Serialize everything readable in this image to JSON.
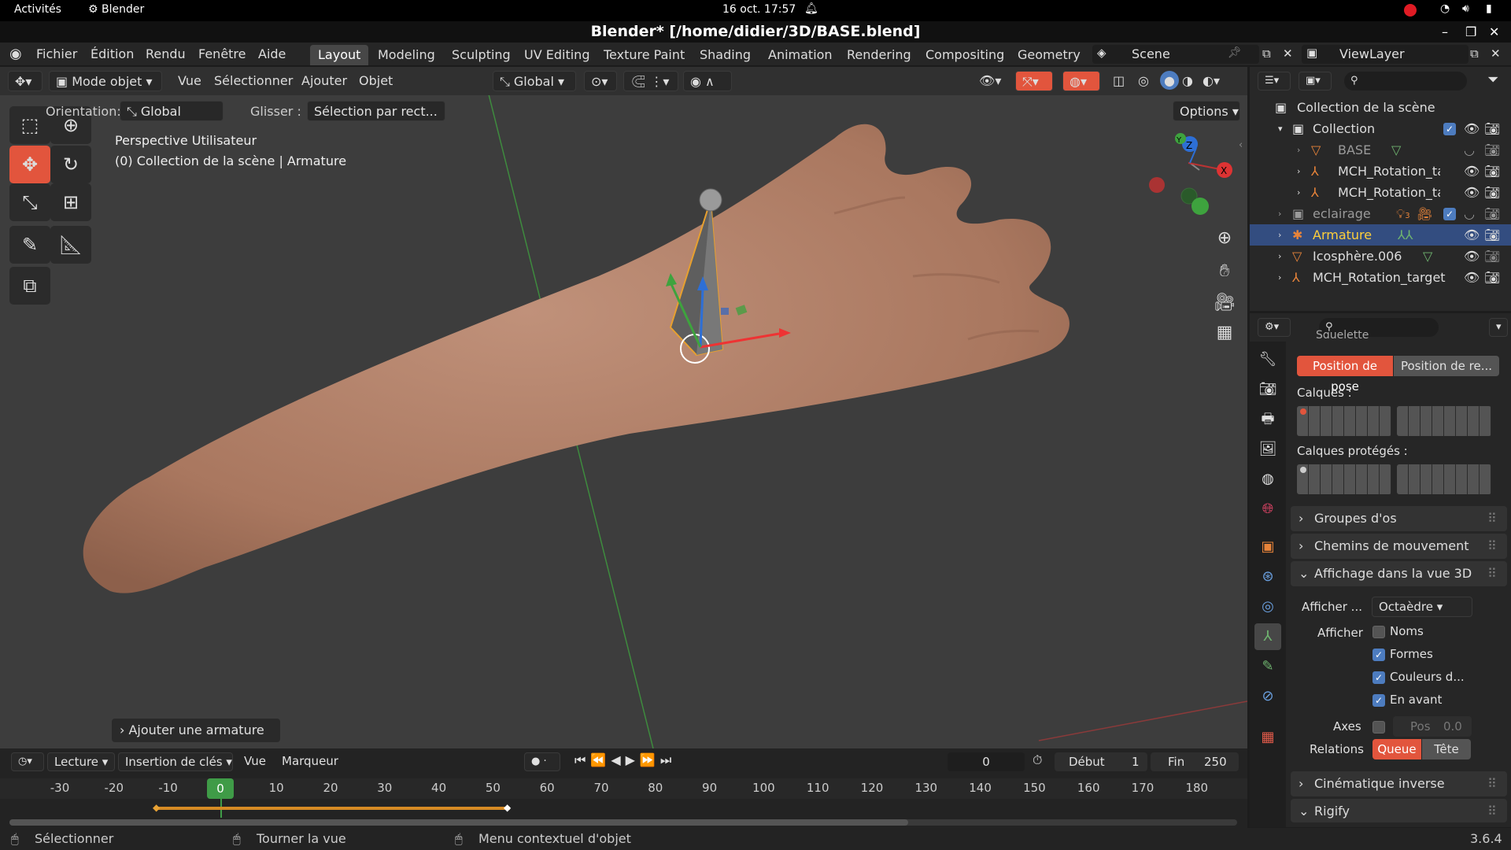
{
  "gnome": {
    "activities": "Activités",
    "app": "Blender",
    "datetime": "16 oct.  17:57"
  },
  "window_title": "Blender* [/home/didier/3D/BASE.blend]",
  "menu": [
    "Fichier",
    "Édition",
    "Rendu",
    "Fenêtre",
    "Aide"
  ],
  "workspaces": [
    "Layout",
    "Modeling",
    "Sculpting",
    "UV Editing",
    "Texture Paint",
    "Shading",
    "Animation",
    "Rendering",
    "Compositing",
    "Geometry N"
  ],
  "scene": {
    "label": "Scene",
    "viewlayer": "ViewLayer"
  },
  "viewport_header": {
    "mode": "Mode objet",
    "menus": [
      "Vue",
      "Sélectionner",
      "Ajouter",
      "Objet"
    ],
    "transform": "Global"
  },
  "tool_settings": {
    "orientation_label": "Orientation:",
    "orientation_value": "Global",
    "drag_label": "Glisser :",
    "drag_value": "Sélection par rect...",
    "options": "Options"
  },
  "viewport_info": {
    "line1": "Perspective Utilisateur",
    "line2": "(0) Collection de la scène | Armature"
  },
  "last_op": "Ajouter une armature",
  "gizmo": {
    "x": "X",
    "y": "Y",
    "z": "Z"
  },
  "outliner": {
    "root": "Collection de la scène",
    "rows": [
      {
        "name": "Collection"
      },
      {
        "name": "BASE"
      },
      {
        "name": "MCH_Rotation_ta"
      },
      {
        "name": "MCH_Rotation_ta"
      },
      {
        "name": "eclairage"
      },
      {
        "name": "Armature"
      },
      {
        "name": "Icosphère.006"
      },
      {
        "name": "MCH_Rotation_target"
      }
    ],
    "eclairage_count": "3"
  },
  "properties": {
    "cut_header": "Squelette",
    "pose_btn": "Position de pose",
    "rest_btn": "Position de re...",
    "layers_label": "Calques :",
    "protected_label": "Calques protégés :",
    "panels": {
      "bone_groups": "Groupes d'os",
      "motion_paths": "Chemins de mouvement",
      "viewport_display": "Affichage dans la vue 3D",
      "ik": "Cinématique inverse",
      "rigify": "Rigify"
    },
    "display_as_label": "Afficher ...",
    "display_as_value": "Octaèdre",
    "show_label": "Afficher",
    "checks": [
      {
        "label": "Noms",
        "on": false
      },
      {
        "label": "Formes",
        "on": true
      },
      {
        "label": "Couleurs d...",
        "on": true
      },
      {
        "label": "En avant",
        "on": true
      }
    ],
    "axes_label": "Axes",
    "axes_pos_label": "Pos",
    "axes_pos_value": "0.0",
    "relations_label": "Relations",
    "relations_a": "Queue",
    "relations_b": "Tête"
  },
  "timeline": {
    "menus": [
      "Lecture",
      "Insertion de clés",
      "Vue",
      "Marqueur"
    ],
    "current_frame": "0",
    "start_label": "Début",
    "start": "1",
    "end_label": "Fin",
    "end": "250",
    "ticks": [
      "-30",
      "-20",
      "-10",
      "0",
      "10",
      "20",
      "30",
      "40",
      "50",
      "60",
      "70",
      "80",
      "90",
      "100",
      "110",
      "120",
      "130",
      "140",
      "150",
      "160",
      "170",
      "180"
    ]
  },
  "status": {
    "left": "Sélectionner",
    "mid": "Tourner la vue",
    "right": "Menu contextuel d'objet",
    "version": "3.6.4"
  },
  "colors": {
    "accent": "#e2553d",
    "selected": "#334d80",
    "active_tool": "#2a4f8b",
    "skin": "#b5836a"
  }
}
